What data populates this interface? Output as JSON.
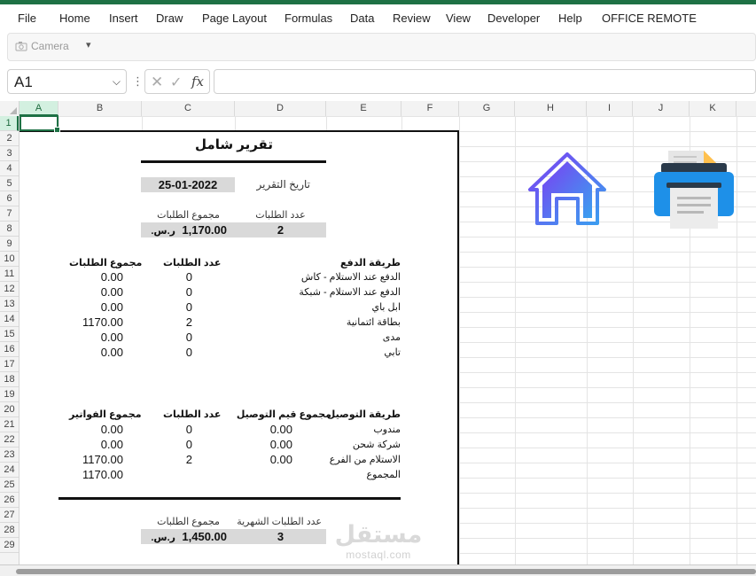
{
  "menu": [
    "File",
    "Home",
    "Insert",
    "Draw",
    "Page Layout",
    "Formulas",
    "Data",
    "Review",
    "View",
    "Developer",
    "Help",
    "OFFICE REMOTE"
  ],
  "ribbon": {
    "camera_label": "Camera",
    "customize_arrow": "▾"
  },
  "formula_bar": {
    "name_box": "A1",
    "formula": "",
    "fx_label": "fx"
  },
  "columns": [
    "A",
    "B",
    "C",
    "D",
    "E",
    "F",
    "G",
    "H",
    "I",
    "J",
    "K"
  ],
  "rows": [
    "1",
    "2",
    "3",
    "4",
    "5",
    "6",
    "7",
    "8",
    "9",
    "10",
    "11",
    "12",
    "13",
    "14",
    "15",
    "16",
    "17",
    "18",
    "19",
    "20",
    "21",
    "22",
    "23",
    "24",
    "25",
    "26",
    "27",
    "28",
    "29"
  ],
  "selected_cell": "A1",
  "report": {
    "title": "تقرير شامل",
    "report_date_label": "تاريخ التقرير",
    "report_date": "25-01-2022",
    "orders_count_label": "عدد الطلبات",
    "orders_total_label": "مجموع الطلبات",
    "orders_count": "2",
    "orders_total": "1,170.00",
    "currency": "ر.س.",
    "payment_section": {
      "headers": {
        "method": "طريقة الدفع",
        "count": "عدد الطلبات",
        "total": "مجموع الطلبات"
      },
      "rows": [
        {
          "method": "الدفع عند الاستلام - كاش",
          "count": "0",
          "total": "0.00"
        },
        {
          "method": "الدفع عند الاستلام - شبكة",
          "count": "0",
          "total": "0.00"
        },
        {
          "method": "ابل باي",
          "count": "0",
          "total": "0.00"
        },
        {
          "method": "بطاقة ائتمانية",
          "count": "2",
          "total": "1170.00"
        },
        {
          "method": "مدى",
          "count": "0",
          "total": "0.00"
        },
        {
          "method": "تابي",
          "count": "0",
          "total": "0.00"
        }
      ]
    },
    "delivery_section": {
      "headers": {
        "method": "طريقة التوصيل",
        "delivery_total": "مجموع قيم التوصيل",
        "count": "عدد الطلبات",
        "invoices_total": "مجموع الفواتير"
      },
      "rows": [
        {
          "method": "مندوب",
          "delivery_total": "0.00",
          "count": "0",
          "invoices_total": "0.00"
        },
        {
          "method": "شركة شحن",
          "delivery_total": "0.00",
          "count": "0",
          "invoices_total": "0.00"
        },
        {
          "method": "الاستلام من الفرع",
          "delivery_total": "0.00",
          "count": "2",
          "invoices_total": "1170.00"
        }
      ],
      "sum_label": "المجموع",
      "sum_value": "1170.00"
    },
    "monthly": {
      "count_label": "عدد الطلبات الشهرية",
      "total_label": "مجموع الطلبات",
      "count": "3",
      "total": "1,450.00",
      "currency": "ر.س."
    }
  },
  "watermark": {
    "arabic": "مستقل",
    "latin": "mostaql.com"
  },
  "icons": {
    "home": "home-icon",
    "print": "printer-icon"
  },
  "colors": {
    "accent": "#1e7145",
    "home_gradient_start": "#7b3ff2",
    "home_gradient_end": "#3aa0f0",
    "printer_body": "#1e90e8",
    "printer_accent": "#f5a623"
  }
}
